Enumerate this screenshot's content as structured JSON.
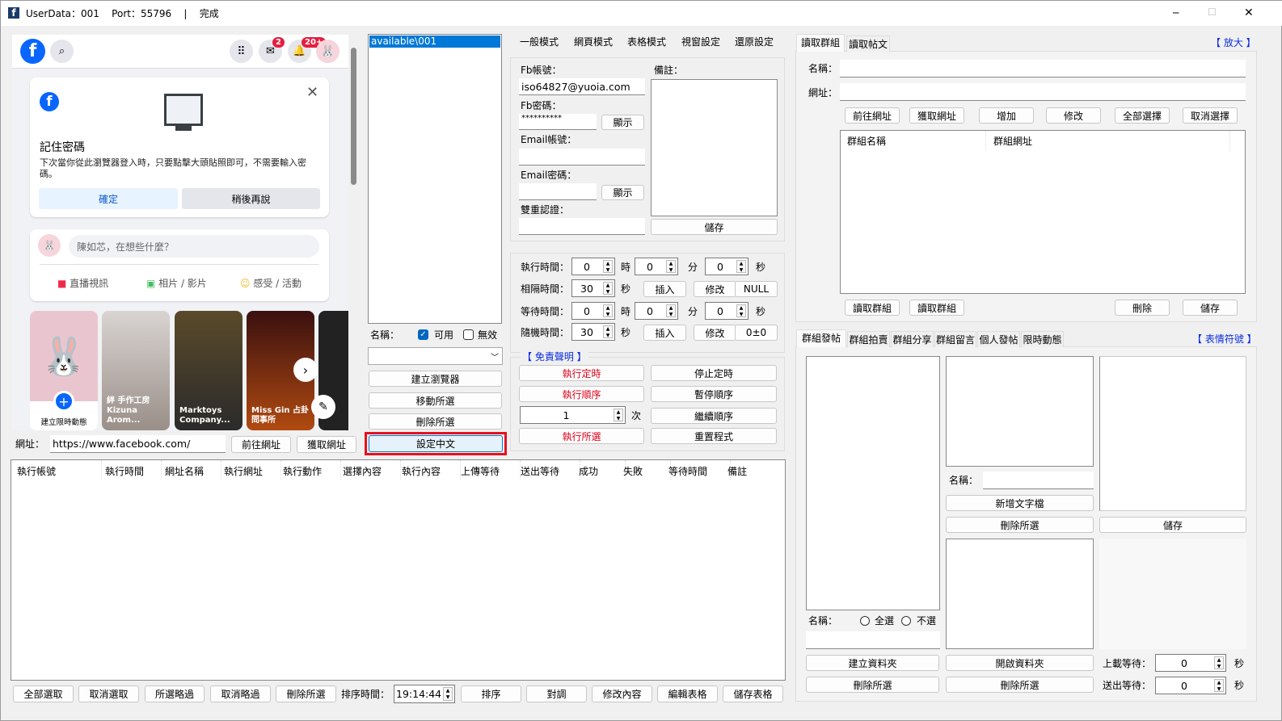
{
  "window": {
    "title": "UserData：001    Port：55796    |    完成",
    "app_icon": "facebook-app-icon",
    "minimize": "─",
    "maximize": "☐",
    "close": "✕"
  },
  "browser": {
    "header": {
      "search_icon": "search-icon",
      "menu_icon": "grid-menu-icon",
      "messenger_badge": "2",
      "notif_badge": "20+"
    },
    "save_password": {
      "title": "記住密碼",
      "body": "下次當你從此瀏覽器登入時，只要點擊大頭貼照即可，不需要輸入密碼。",
      "confirm": "確定",
      "later": "稍後再說"
    },
    "composer": {
      "placeholder": "陳如芯，在想些什麼？",
      "live": "直播視訊",
      "photo": "相片 / 影片",
      "feeling": "感受 / 活動"
    },
    "stories": [
      {
        "label": "建立限時動態"
      },
      {
        "label": "絆 手作工房 Kizuna Arom..."
      },
      {
        "label": "Marktoys Company..."
      },
      {
        "label": "Miss Gin 占卦 問事所"
      }
    ],
    "url_label": "網址：",
    "url": "https://www.facebook.com/",
    "goto": "前往網址",
    "fetch": "獲取網址"
  },
  "profiles": {
    "items": [
      "available\\001"
    ],
    "name_label": "名稱：",
    "enabled": "可用",
    "disabled": "無效",
    "enabled_checked": true,
    "disabled_checked": false,
    "buttons": [
      "建立瀏覽器",
      "移動所選",
      "刪除所選",
      "設定中文"
    ]
  },
  "menu": [
    "一般模式",
    "網頁模式",
    "表格模式",
    "視窗設定",
    "還原設定"
  ],
  "account": {
    "fb_account_label": "Fb帳號：",
    "fb_account": "iso64827@yuoia.com",
    "fb_password_label": "Fb密碼：",
    "fb_password": "**********",
    "show": "顯示",
    "email_label": "Email帳號：",
    "email": "",
    "email_password_label": "Email密碼：",
    "email_password": "",
    "twofa_label": "雙重認證：",
    "twofa": "",
    "note_label": "備註：",
    "save": "儲存"
  },
  "timing": {
    "exec_label": "執行時間：",
    "interval_label": "相隔時間：",
    "wait_label": "等待時間：",
    "random_label": "隨機時間：",
    "exec": [
      "0",
      "0",
      "0"
    ],
    "interval": "30",
    "wait": [
      "0",
      "0",
      "0"
    ],
    "random": "30",
    "hour": "時",
    "minute": "分",
    "second": "秒",
    "insert": "插入",
    "modify": "修改",
    "null": "NULL",
    "pm": "0±0"
  },
  "control": {
    "disclaimer": "【 免責聲明 】",
    "start_timer": "執行定時",
    "stop_timer": "停止定時",
    "run_seq": "執行順序",
    "pause_seq": "暫停順序",
    "count": "1",
    "times": "次",
    "resume_seq": "繼續順序",
    "run_selected": "執行所選",
    "reset": "重置程式"
  },
  "table": {
    "columns": [
      "執行帳號",
      "執行時間",
      "網址名稱",
      "執行網址",
      "執行動作",
      "選擇內容",
      "執行內容",
      "上傳等待",
      "送出等待",
      "成功",
      "失敗",
      "等待時間",
      "備註"
    ],
    "footer": {
      "select_all": "全部選取",
      "deselect": "取消選取",
      "skip_selected": "所選略過",
      "cancel_skip": "取消略過",
      "delete_selected": "刪除所選",
      "sort_time_label": "排序時間：",
      "sort_time": "19:14:44",
      "sort": "排序",
      "swap": "對調",
      "edit_content": "修改內容",
      "edit_table": "編輯表格",
      "save_table": "儲存表格"
    }
  },
  "groups": {
    "tabs": [
      "讀取群組",
      "讀取帖文"
    ],
    "zoom": "【 放大 】",
    "name_label": "名稱：",
    "url_label": "網址：",
    "name": "",
    "url": "",
    "buttons": [
      "前往網址",
      "獲取網址",
      "增加",
      "修改",
      "全部選擇",
      "取消選擇"
    ],
    "columns": [
      "群組名稱",
      "群組網址"
    ],
    "bottom_buttons": [
      "讀取群組",
      "讀取群組",
      "刪除",
      "儲存"
    ]
  },
  "posting": {
    "tabs": [
      "群組發帖",
      "群組拍賣",
      "群組分享",
      "群組留言",
      "個人發帖",
      "限時動態"
    ],
    "emoji": "【 表情符號 】",
    "name_label": "名稱：",
    "select_all": "全選",
    "select_none": "不選",
    "name2_label": "名稱：",
    "new_text": "新增文字檔",
    "delete_selected": "刪除所選",
    "save": "儲存",
    "create_folder": "建立資料夾",
    "open_folder": "開啟資料夾",
    "upload_wait_label": "上載等待：",
    "upload_wait": "0",
    "send_wait_label": "送出等待：",
    "send_wait": "0",
    "sec": "秒"
  }
}
